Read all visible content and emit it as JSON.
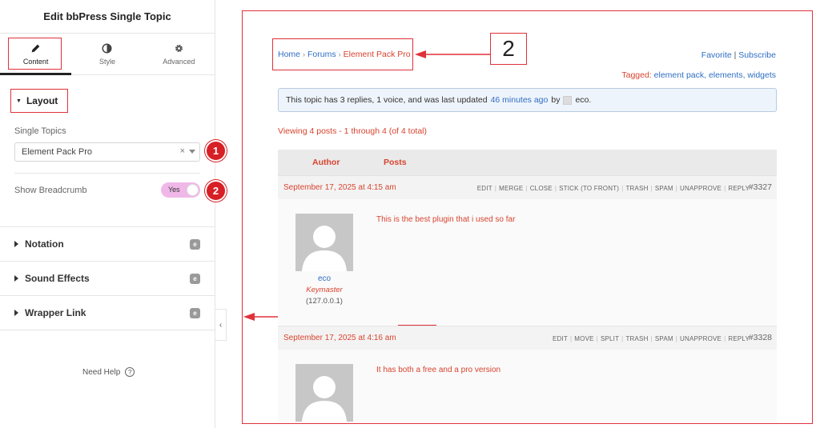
{
  "panel": {
    "title": "Edit bbPress Single Topic",
    "tabs": [
      {
        "label": "Content",
        "icon": "pencil-icon"
      },
      {
        "label": "Style",
        "icon": "half-circle-icon"
      },
      {
        "label": "Advanced",
        "icon": "gear-icon"
      }
    ],
    "layout": {
      "title": "Layout",
      "single_topics_label": "Single Topics",
      "single_topics_value": "Element Pack Pro",
      "show_breadcrumb_label": "Show Breadcrumb",
      "show_breadcrumb_value": "Yes"
    },
    "sections": [
      "Notation",
      "Sound Effects",
      "Wrapper Link"
    ],
    "need_help": "Need Help",
    "badges": [
      "1",
      "2"
    ]
  },
  "preview": {
    "breadcrumb": {
      "home": "Home",
      "forums": "Forums",
      "current": "Element Pack Pro"
    },
    "favorite": "Favorite",
    "subscribe": "Subscribe",
    "tagged_label": "Tagged:",
    "tags": "element pack, elements, widgets",
    "info": {
      "prefix": "This topic has 3 replies, 1 voice, and was last updated",
      "time": "46 minutes ago",
      "by": "by",
      "user": "eco."
    },
    "viewing": "Viewing 4 posts - 1 through 4 (of 4 total)",
    "table_head": {
      "author": "Author",
      "posts": "Posts"
    },
    "posts": [
      {
        "date": "September 17, 2025 at 4:15 am",
        "actions": [
          "EDIT",
          "MERGE",
          "CLOSE",
          "STICK (TO FRONT)",
          "TRASH",
          "SPAM",
          "UNAPPROVE",
          "REPLY"
        ],
        "number": "#3327",
        "text": "This is the best plugin that i used so far",
        "author": "eco",
        "role": "Keymaster",
        "ip": "(127.0.0.1)"
      },
      {
        "date": "September 17, 2025 at 4:16 am",
        "actions": [
          "EDIT",
          "MOVE",
          "SPLIT",
          "TRASH",
          "SPAM",
          "UNAPPROVE",
          "REPLY"
        ],
        "number": "#3328",
        "text": "It has both a free and a pro version"
      }
    ],
    "callouts": [
      "2",
      "1"
    ]
  }
}
